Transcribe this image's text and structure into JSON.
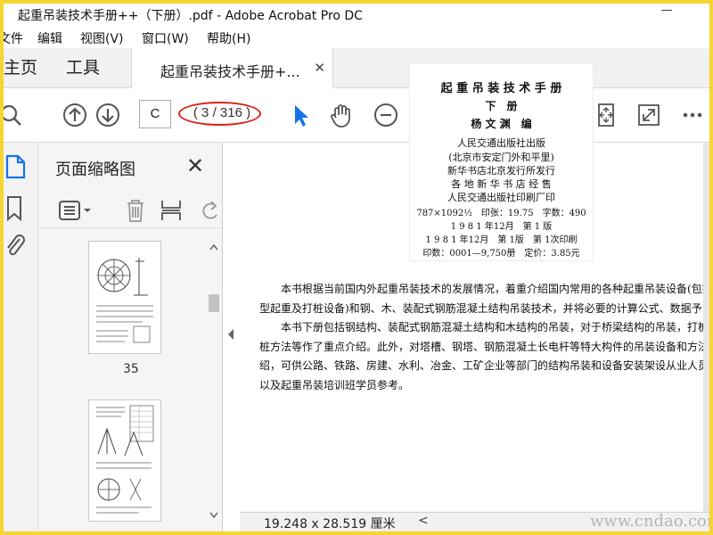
{
  "window": {
    "title": "起重吊装技术手册++（下册）.pdf - Adobe Acrobat Pro DC",
    "minimize_glyph": "—"
  },
  "menu": [
    "文件",
    "编辑",
    "视图(V)",
    "窗口(W)",
    "帮助(H)"
  ],
  "tabs": {
    "home": "主页",
    "tools": "工具",
    "document": "起重吊装技术手册+...",
    "close_glyph": "✕"
  },
  "toolbar": {
    "page_input": "C",
    "page_count": "( 3 / 316 )",
    "icons": [
      "search-icon",
      "prev-page-icon",
      "next-page-icon",
      "select-cursor-icon",
      "hand-tool-icon",
      "zoom-out-icon",
      "fit-page-icon",
      "full-screen-icon",
      "more-icon"
    ]
  },
  "accent_color": "#1473e6",
  "highlight_color": "#d9231a",
  "panel": {
    "title": "页面缩略图",
    "close_glyph": "✕",
    "thumbnails": [
      {
        "page_label": "35"
      },
      {
        "page_label": ""
      }
    ]
  },
  "copyright_page": {
    "title": "起 重 吊 装 技 术 手 册",
    "volume": "下　册",
    "editor": "杨 文 渊　编",
    "publisher": "人民交通出版社出版",
    "address": "(北京市安定门外和平里)",
    "distribution": "新华书店北京发行所发行",
    "sellers": "各 地 新 华 书 店 经 售",
    "printer": "人民交通出版社印刷厂印",
    "format": "787×1092½　印张：19.75　字数：490",
    "edition": "1 9 8 1 年12月　第 1 版",
    "printing": "1 9 8 1 年12月　第 1版　第 1次印刷",
    "print_run": "印数：0001—9,750册　定价：3.85元"
  },
  "document_text": [
    "　　本书根据当前国内外起重吊装技术的发展情况，着重介绍国内常用的各种起重吊装设备(包括部分",
    "型起重及打桩设备)和钢、木、装配式钢筋混凝土结构吊装技术，并将必要的计算公式、数据予以图表",
    "　　本书下册包括钢结构、装配式钢筋混凝土结构和木结构的吊装，对于桥梁结构的吊装，打桩机具",
    "桩方法等作了重点介绍。此外，对塔槽、钢塔、钢筋混凝土长电杆等特大构件的吊装设备和方法也有",
    "绍，可供公路、铁路、房建、水利、冶金、工矿企业等部门的结构吊装和设备安装架设从业人员、大",
    "以及起重吊装培训班学员参考。"
  ],
  "status": {
    "dimensions": "19.248 x 28.519 厘米",
    "scroll_arrow": "<",
    "watermark": "www.cndao.com"
  }
}
